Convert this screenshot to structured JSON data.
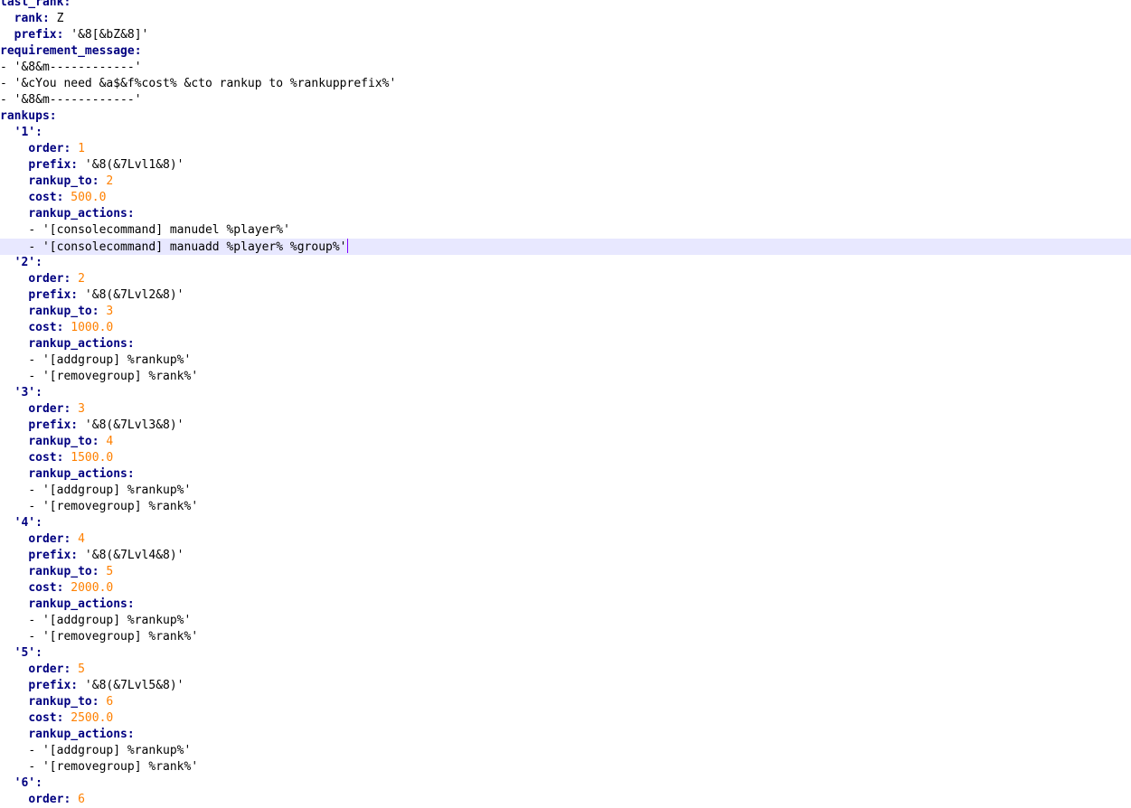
{
  "editor": {
    "language": "YAML",
    "current_line_index": 15,
    "lines": [
      {
        "indent": "",
        "key": "last_rank:",
        "value": "",
        "value_type": "str"
      },
      {
        "indent": "  ",
        "key": "rank:",
        "value": " Z",
        "value_type": "str"
      },
      {
        "indent": "  ",
        "key": "prefix:",
        "value": " '&8[&bZ&8]'",
        "value_type": "str"
      },
      {
        "indent": "",
        "key": "requirement_message:",
        "value": "",
        "value_type": "str"
      },
      {
        "indent": "",
        "key": "",
        "value": "- '&8&m------------'",
        "value_type": "str"
      },
      {
        "indent": "",
        "key": "",
        "value": "- '&cYou need &a$&f%cost% &cto rankup to %rankupprefix%'",
        "value_type": "str"
      },
      {
        "indent": "",
        "key": "",
        "value": "- '&8&m------------'",
        "value_type": "str"
      },
      {
        "indent": "",
        "key": "rankups:",
        "value": "",
        "value_type": "str"
      },
      {
        "indent": "  ",
        "key": "'1':",
        "value": "",
        "value_type": "str"
      },
      {
        "indent": "    ",
        "key": "order:",
        "value": " 1",
        "value_type": "num"
      },
      {
        "indent": "    ",
        "key": "prefix:",
        "value": " '&8(&7Lvl1&8)'",
        "value_type": "str"
      },
      {
        "indent": "    ",
        "key": "rankup_to:",
        "value": " 2",
        "value_type": "num"
      },
      {
        "indent": "    ",
        "key": "cost:",
        "value": " 500.0",
        "value_type": "num"
      },
      {
        "indent": "    ",
        "key": "rankup_actions:",
        "value": "",
        "value_type": "str"
      },
      {
        "indent": "    ",
        "key": "",
        "value": "- '[consolecommand] manudel %player%'",
        "value_type": "str"
      },
      {
        "indent": "    ",
        "key": "",
        "value": "- '[consolecommand] manuadd %player% %group%'",
        "value_type": "str"
      },
      {
        "indent": "  ",
        "key": "'2':",
        "value": "",
        "value_type": "str"
      },
      {
        "indent": "    ",
        "key": "order:",
        "value": " 2",
        "value_type": "num"
      },
      {
        "indent": "    ",
        "key": "prefix:",
        "value": " '&8(&7Lvl2&8)'",
        "value_type": "str"
      },
      {
        "indent": "    ",
        "key": "rankup_to:",
        "value": " 3",
        "value_type": "num"
      },
      {
        "indent": "    ",
        "key": "cost:",
        "value": " 1000.0",
        "value_type": "num"
      },
      {
        "indent": "    ",
        "key": "rankup_actions:",
        "value": "",
        "value_type": "str"
      },
      {
        "indent": "    ",
        "key": "",
        "value": "- '[addgroup] %rankup%'",
        "value_type": "str"
      },
      {
        "indent": "    ",
        "key": "",
        "value": "- '[removegroup] %rank%'",
        "value_type": "str"
      },
      {
        "indent": "  ",
        "key": "'3':",
        "value": "",
        "value_type": "str"
      },
      {
        "indent": "    ",
        "key": "order:",
        "value": " 3",
        "value_type": "num"
      },
      {
        "indent": "    ",
        "key": "prefix:",
        "value": " '&8(&7Lvl3&8)'",
        "value_type": "str"
      },
      {
        "indent": "    ",
        "key": "rankup_to:",
        "value": " 4",
        "value_type": "num"
      },
      {
        "indent": "    ",
        "key": "cost:",
        "value": " 1500.0",
        "value_type": "num"
      },
      {
        "indent": "    ",
        "key": "rankup_actions:",
        "value": "",
        "value_type": "str"
      },
      {
        "indent": "    ",
        "key": "",
        "value": "- '[addgroup] %rankup%'",
        "value_type": "str"
      },
      {
        "indent": "    ",
        "key": "",
        "value": "- '[removegroup] %rank%'",
        "value_type": "str"
      },
      {
        "indent": "  ",
        "key": "'4':",
        "value": "",
        "value_type": "str"
      },
      {
        "indent": "    ",
        "key": "order:",
        "value": " 4",
        "value_type": "num"
      },
      {
        "indent": "    ",
        "key": "prefix:",
        "value": " '&8(&7Lvl4&8)'",
        "value_type": "str"
      },
      {
        "indent": "    ",
        "key": "rankup_to:",
        "value": " 5",
        "value_type": "num"
      },
      {
        "indent": "    ",
        "key": "cost:",
        "value": " 2000.0",
        "value_type": "num"
      },
      {
        "indent": "    ",
        "key": "rankup_actions:",
        "value": "",
        "value_type": "str"
      },
      {
        "indent": "    ",
        "key": "",
        "value": "- '[addgroup] %rankup%'",
        "value_type": "str"
      },
      {
        "indent": "    ",
        "key": "",
        "value": "- '[removegroup] %rank%'",
        "value_type": "str"
      },
      {
        "indent": "  ",
        "key": "'5':",
        "value": "",
        "value_type": "str"
      },
      {
        "indent": "    ",
        "key": "order:",
        "value": " 5",
        "value_type": "num"
      },
      {
        "indent": "    ",
        "key": "prefix:",
        "value": " '&8(&7Lvl5&8)'",
        "value_type": "str"
      },
      {
        "indent": "    ",
        "key": "rankup_to:",
        "value": " 6",
        "value_type": "num"
      },
      {
        "indent": "    ",
        "key": "cost:",
        "value": " 2500.0",
        "value_type": "num"
      },
      {
        "indent": "    ",
        "key": "rankup_actions:",
        "value": "",
        "value_type": "str"
      },
      {
        "indent": "    ",
        "key": "",
        "value": "- '[addgroup] %rankup%'",
        "value_type": "str"
      },
      {
        "indent": "    ",
        "key": "",
        "value": "- '[removegroup] %rank%'",
        "value_type": "str"
      },
      {
        "indent": "  ",
        "key": "'6':",
        "value": "",
        "value_type": "str"
      },
      {
        "indent": "    ",
        "key": "order:",
        "value": " 6",
        "value_type": "num"
      }
    ]
  },
  "colors": {
    "key": "#000080",
    "number": "#ff8000",
    "string": "#000000",
    "current_line": "#e8e8ff",
    "caret": "#8000ff"
  }
}
